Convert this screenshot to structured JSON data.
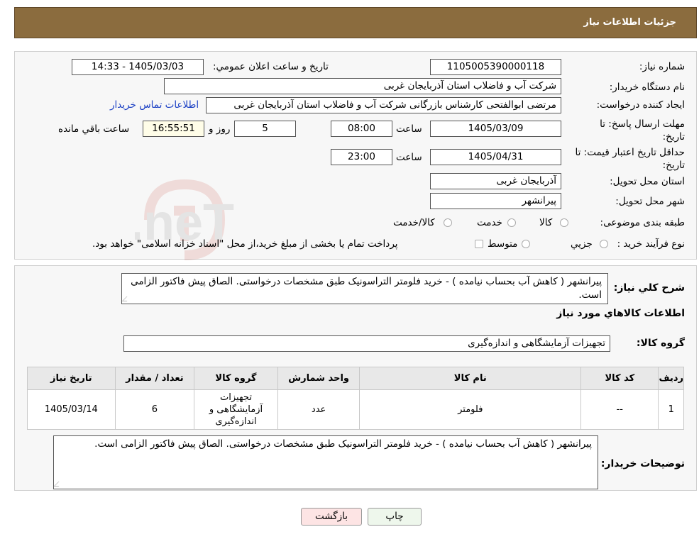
{
  "header": {
    "title": "جزئیات اطلاعات نیاز"
  },
  "form": {
    "need_number_label": "شماره نیاز:",
    "need_number": "1105005390000118",
    "announce_label": "تاریخ و ساعت اعلان عمومي:",
    "announce_value": "1405/03/03 - 14:33",
    "buyer_org_label": "نام دستگاه خريدار:",
    "buyer_org": "شرکت آب و فاضلاب استان آذربایجان غربی",
    "creator_label": "ایجاد کننده درخواست:",
    "creator": "مرتضی ابوالفتحی کارشناس بازرگانی شرکت آب و فاضلاب استان آذربایجان غربی",
    "contact_link": "اطلاعات تماس خریدار",
    "deadline_label": "مهلت ارسال پاسخ: تا تاریخ:",
    "deadline_date": "1405/03/09",
    "time_label": "ساعت",
    "deadline_time": "08:00",
    "days_value": "5",
    "days_label": "روز و",
    "remaining_time": "16:55:51",
    "remaining_label": "ساعت باقي مانده",
    "validity_label": "حداقل تاریخ اعتبار قیمت: تا تاریخ:",
    "validity_date": "1405/04/31",
    "validity_time": "23:00",
    "province_label": "استان محل تحویل:",
    "province": "آذربایجان غربی",
    "city_label": "شهر محل تحویل:",
    "city": "پیرانشهر",
    "category_label": "طبقه بندی موضوعی:",
    "category_options": [
      "کالا",
      "خدمت",
      "کالا/خدمت"
    ],
    "process_label": "نوع فرآیند خرید :",
    "process_options": [
      "جزیي",
      "متوسط"
    ],
    "process_note": "پرداخت تمام یا بخشی از مبلغ خرید،از محل \"اسناد خزانه اسلامی\" خواهد بود."
  },
  "summary": {
    "desc_label": "شرح کلي نياز:",
    "desc_text": "پیرانشهر ( کاهش آب بحساب نیامده ) - خرید فلومتر التراسونیک طبق مشخصات درخواستی. الصاق پیش فاکتور الزامی است.",
    "items_heading": "اطلاعات کالاهاي مورد نياز",
    "group_label": "گروه کالا:",
    "group_value": "تجهیزات آزمایشگاهی و اندازه‌گیری"
  },
  "table": {
    "headers": [
      "رديف",
      "کد کالا",
      "نام کالا",
      "واحد شمارش",
      "گروه کالا",
      "تعداد / مقدار",
      "تاريخ نياز"
    ],
    "rows": [
      [
        "1",
        "--",
        "فلومتر",
        "عدد",
        "تجهیزات آزمایشگاهی و اندازه‌گیری",
        "6",
        "1405/03/14"
      ]
    ]
  },
  "buyer_notes": {
    "label": "توضيحات خريدار:",
    "text": "پیرانشهر ( کاهش آب بحساب نیامده ) - خرید فلومتر التراسونیک طبق مشخصات درخواستی. الصاق پیش فاکتور الزامی است."
  },
  "buttons": {
    "print": "چاپ",
    "back": "بازگشت"
  },
  "watermark_text": "AriaTender.neT",
  "colors": {
    "header_bg": "#8b6c3e",
    "back_button_bg": "#fde4e4",
    "print_button_bg": "#eef7ec",
    "link": "#1a3fc4"
  }
}
